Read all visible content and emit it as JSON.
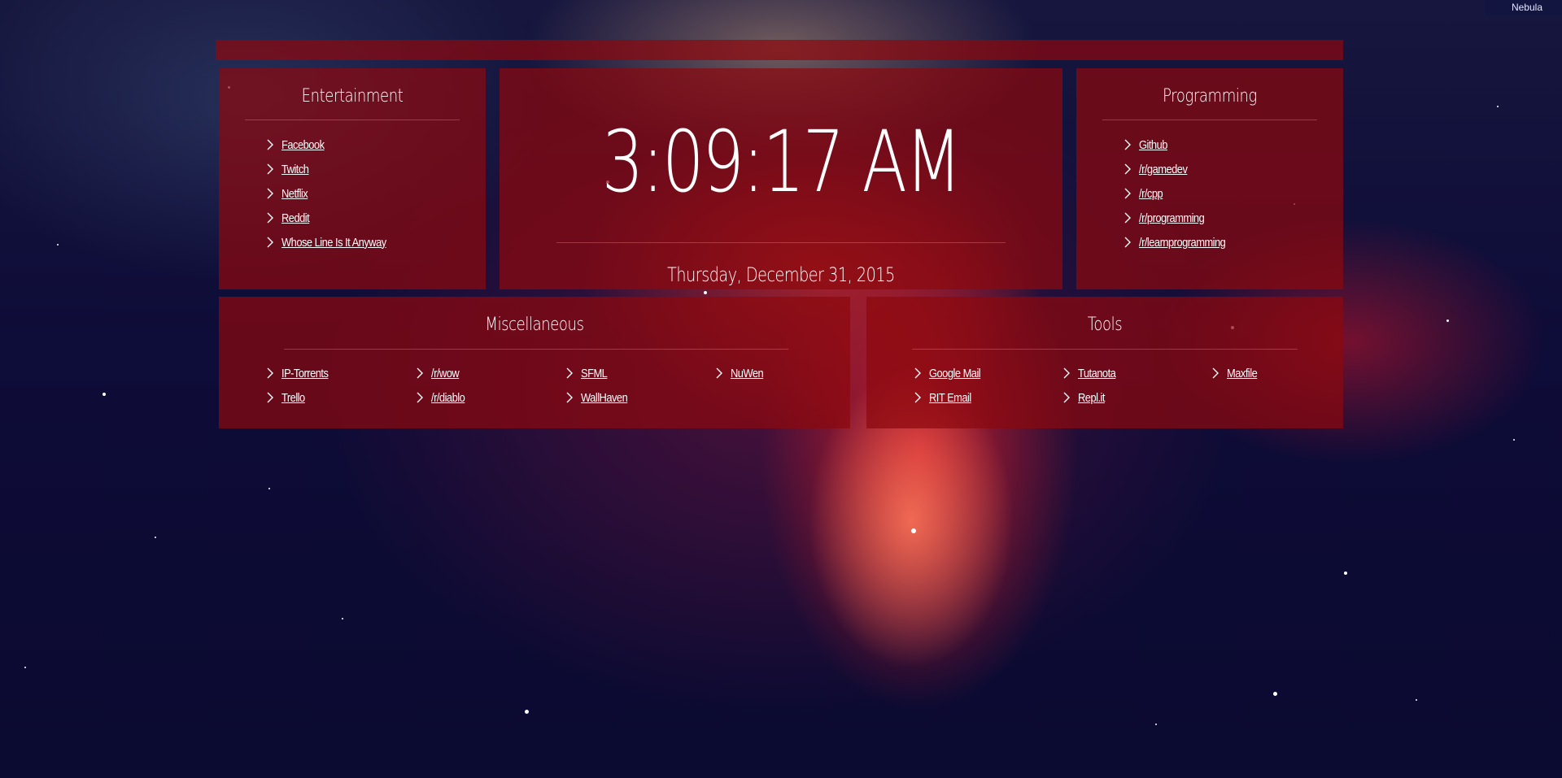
{
  "window": {
    "tab_title": "Nebula"
  },
  "entertainment": {
    "title": "Entertainment",
    "links": [
      "Facebook",
      "Twitch",
      "Netflix",
      "Reddit",
      "Whose Line Is It Anyway"
    ]
  },
  "clock": {
    "time": "3:09:17 AM",
    "date": "Thursday, December 31, 2015"
  },
  "programming": {
    "title": "Programming",
    "links": [
      "Github",
      "/r/gamedev",
      "/r/cpp",
      "/r/programming",
      "/r/learnprogramming"
    ]
  },
  "miscellaneous": {
    "title": "Miscellaneous",
    "links": [
      "IP-Torrents",
      "/r/wow",
      "SFML",
      "NuWen",
      "Trello",
      "/r/diablo",
      "WallHaven"
    ]
  },
  "tools": {
    "title": "Tools",
    "links": [
      "Google Mail",
      "Tutanota",
      "Maxfile",
      "RIT Email",
      "Repl.it"
    ]
  },
  "theme": {
    "panel_color": "#8c080e",
    "text_color": "#ffffff"
  },
  "icons": {
    "link_bullet": "chevron-right-icon"
  }
}
